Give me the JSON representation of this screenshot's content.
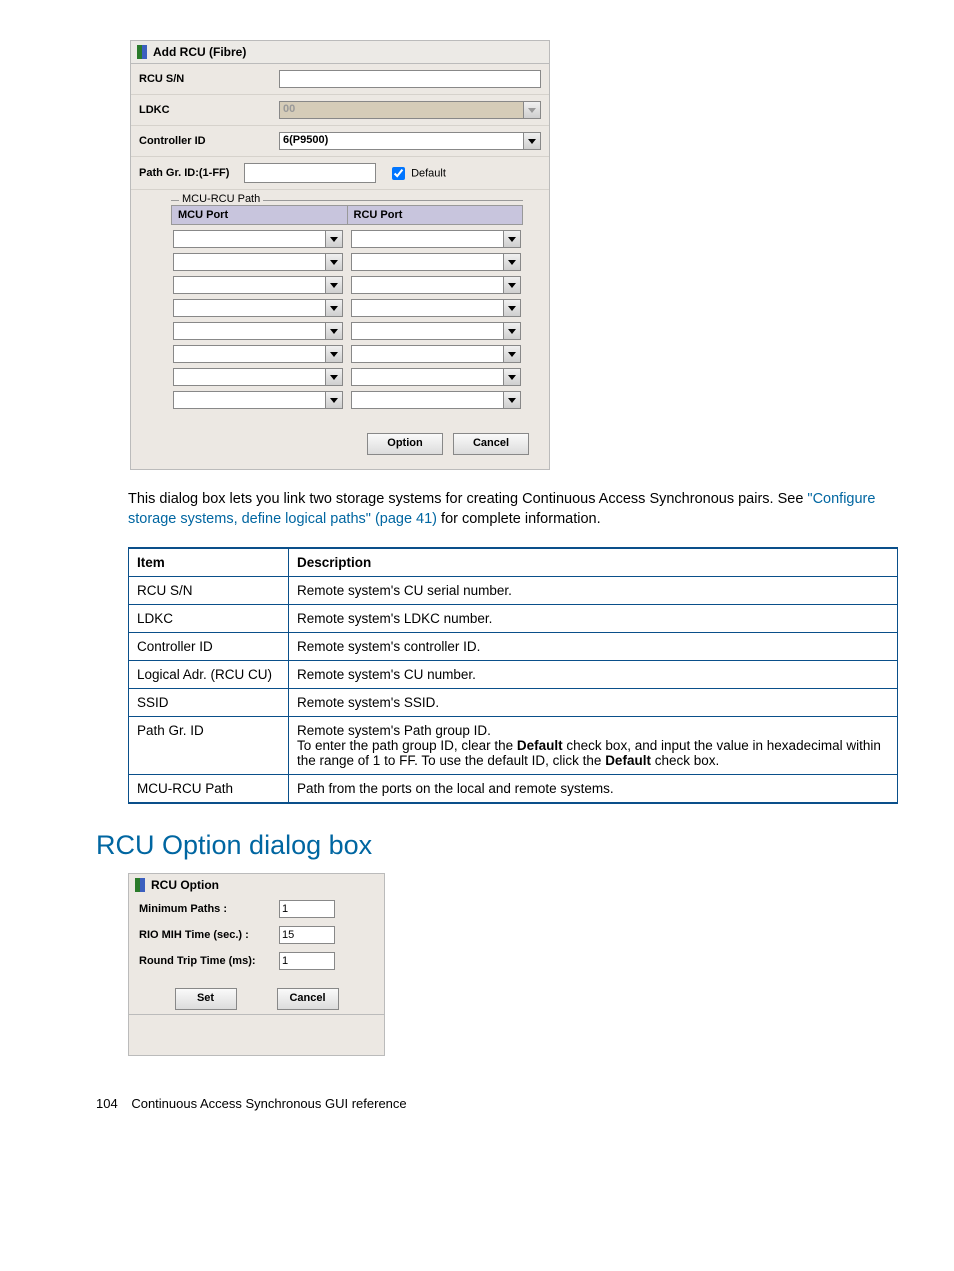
{
  "dialog1": {
    "title": "Add RCU (Fibre)",
    "rows": {
      "rcu_sn": "RCU S/N",
      "ldkc": "LDKC",
      "ldkc_val": "00",
      "controller_id": "Controller ID",
      "controller_val": "6(P9500)",
      "path_gr": "Path Gr. ID:(1-FF)",
      "default_label": "Default"
    },
    "mcu_legend": "MCU-RCU Path",
    "mcu_head": "MCU Port",
    "rcu_head": "RCU Port",
    "option_btn": "Option",
    "cancel_btn": "Cancel"
  },
  "para": {
    "t1": "This dialog box lets you link two storage systems for creating Continuous Access Synchronous pairs. See ",
    "link": "\"Configure storage systems, define logical paths\" (page 41)",
    "t2": " for complete information."
  },
  "table": {
    "h1": "Item",
    "h2": "Description",
    "rows": [
      {
        "item": "RCU S/N",
        "desc": "Remote system's CU serial number."
      },
      {
        "item": "LDKC",
        "desc": "Remote system's LDKC number."
      },
      {
        "item": "Controller ID",
        "desc": "Remote system's controller ID."
      },
      {
        "item": "Logical Adr. (RCU CU)",
        "desc": "Remote system's CU number."
      },
      {
        "item": "SSID",
        "desc": "Remote system's SSID."
      },
      {
        "item": "Path Gr. ID",
        "desc_html": "path"
      },
      {
        "item": "MCU-RCU Path",
        "desc": "Path from the ports on the local and remote systems."
      }
    ],
    "path_desc": {
      "l1": "Remote system's Path group ID.",
      "l2a": "To enter the path group ID, clear the ",
      "l2b": "Default",
      "l2c": " check box, and input the value in hexadecimal within the range of 1 to FF. To use the default ID, click the ",
      "l2d": "Default",
      "l2e": " check box."
    }
  },
  "heading": "RCU Option dialog box",
  "dialog2": {
    "title": "RCU Option",
    "min_paths": "Minimum Paths :",
    "min_paths_val": "1",
    "rio": "RIO MIH Time (sec.) :",
    "rio_val": "15",
    "rtt": "Round Trip Time (ms):",
    "rtt_val": "1",
    "set_btn": "Set",
    "cancel_btn": "Cancel"
  },
  "footer": {
    "page": "104",
    "text": "Continuous Access Synchronous GUI reference"
  }
}
